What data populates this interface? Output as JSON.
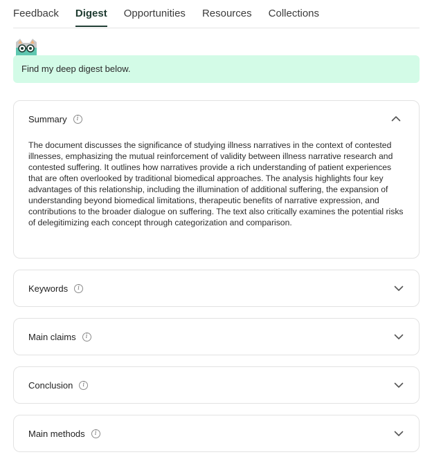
{
  "tabs": [
    {
      "label": "Feedback",
      "active": false
    },
    {
      "label": "Digest",
      "active": true
    },
    {
      "label": "Opportunities",
      "active": false
    },
    {
      "label": "Resources",
      "active": false
    },
    {
      "label": "Collections",
      "active": false
    }
  ],
  "banner": {
    "text": "Find my deep digest below."
  },
  "sections": {
    "summary": {
      "title": "Summary",
      "expanded": true,
      "body": "The document discusses the significance of studying illness narratives in the context of contested illnesses, emphasizing the mutual reinforcement of validity between illness narrative research and contested suffering. It outlines how narratives provide a rich understanding of patient experiences that are often overlooked by traditional biomedical approaches. The analysis highlights four key advantages of this relationship, including the illumination of additional suffering, the expansion of understanding beyond biomedical limitations, therapeutic benefits of narrative expression, and contributions to the broader dialogue on suffering. The text also critically examines the potential risks of delegitimizing each concept through categorization and comparison."
    },
    "keywords": {
      "title": "Keywords",
      "expanded": false
    },
    "main_claims": {
      "title": "Main claims",
      "expanded": false
    },
    "conclusion": {
      "title": "Conclusion",
      "expanded": false
    },
    "main_methods": {
      "title": "Main methods",
      "expanded": false
    }
  },
  "colors": {
    "banner_bg": "#d3fbe7",
    "active_tab": "#1e3b30"
  }
}
